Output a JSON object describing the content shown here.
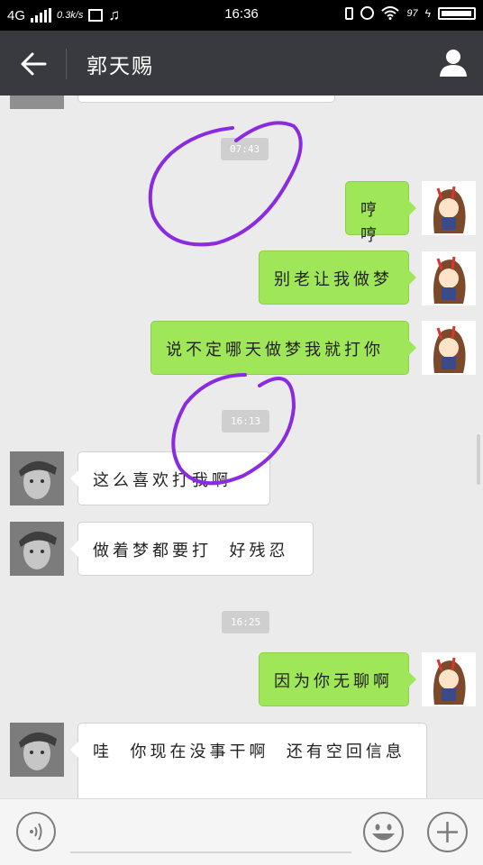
{
  "status_bar": {
    "network": "4G",
    "speed": "0.3k/s",
    "time": "16:36",
    "battery": "97"
  },
  "header": {
    "title": "郭天赐",
    "back_icon": "arrow-left-icon",
    "profile_icon": "person-icon"
  },
  "messages": [
    {
      "type": "time",
      "text": "07:43"
    },
    {
      "type": "sent",
      "text": "哼哼"
    },
    {
      "type": "sent",
      "text": "别老让我做梦"
    },
    {
      "type": "sent",
      "text": "说不定哪天做梦我就打你"
    },
    {
      "type": "time",
      "text": "16:13"
    },
    {
      "type": "received",
      "text": "这么喜欢打我啊"
    },
    {
      "type": "received",
      "text": "做着梦都要打  好残忍"
    },
    {
      "type": "time",
      "text": "16:25"
    },
    {
      "type": "sent",
      "text": "因为你无聊啊"
    },
    {
      "type": "received",
      "text": "哇  你现在没事干啊  还有空回信息"
    }
  ],
  "input_bar": {
    "voice_icon": "voice-icon",
    "emoji_icon": "emoji-icon",
    "plus_icon": "plus-icon"
  },
  "colors": {
    "header_bg": "#393a3f",
    "chat_bg": "#ebebeb",
    "sent_bubble": "#9fe658",
    "received_bubble": "#ffffff",
    "annotation": "#8a2be2"
  }
}
